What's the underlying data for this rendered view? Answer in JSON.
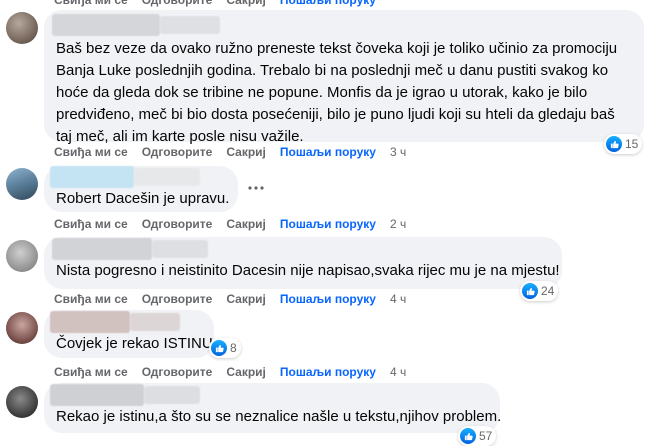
{
  "actions": {
    "like": "Свиђа ми се",
    "reply": "Одговорите",
    "hide": "Сакриј",
    "send_message": "Пошаљи поруку"
  },
  "comments": [
    {
      "author": "",
      "text": "Baš bez veze da ovako ružno preneste tekst čoveka koji je toliko učinio za promociju Banja Luke poslednjih godina. Trebalo bi na poslednji meč u danu pustiti svakog ko hoće da gleda dok se tribine ne popune. Monfis da je igrao u utorak, kako je bilo predviđeno, meč bi bio dosta posećeniji, bilo je puno ljudi koji su hteli da gledaju baš taj meč, ali im karte posle nisu važile.",
      "time": "3 ч",
      "reactions": "15"
    },
    {
      "author": "",
      "text": "Robert Dacešin je upravu.",
      "time": "2 ч",
      "reactions": ""
    },
    {
      "author": "",
      "text": "Nista pogresno i neistinito Dacesin nije napisao,svaka rijec mu je na mjestu!",
      "time": "4 ч",
      "reactions": "24"
    },
    {
      "author": "",
      "text": "Čovjek je rekao ISTINU",
      "time": "4 ч",
      "reactions": "8"
    },
    {
      "author": "",
      "text": "Rekao je istinu,a što su se neznalice našle u tekstu,njihov problem.",
      "time": "",
      "reactions": "57"
    }
  ],
  "colors": {
    "bubble": "#f0f2f5",
    "action_text": "#65676b",
    "like_blue": "#0866ff"
  },
  "icons": [
    "like-icon",
    "more-options-icon",
    "avatar"
  ]
}
